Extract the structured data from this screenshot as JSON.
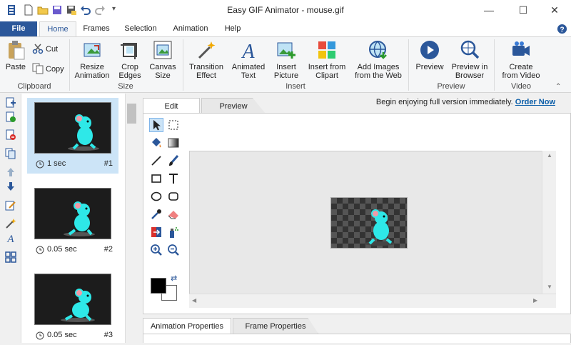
{
  "title": "Easy GIF Animator - mouse.gif",
  "window_controls": {
    "minimize": "—",
    "maximize": "☐",
    "close": "✕"
  },
  "ribbon_tabs": [
    "File",
    "Home",
    "Frames",
    "Selection",
    "Animation",
    "Help"
  ],
  "clipboard": {
    "paste": "Paste",
    "cut": "Cut",
    "copy": "Copy",
    "label": "Clipboard"
  },
  "size_group": {
    "resize": [
      "Resize",
      "Animation"
    ],
    "crop": [
      "Crop",
      "Edges"
    ],
    "canvas": [
      "Canvas",
      "Size"
    ],
    "label": "Size"
  },
  "insert_group": {
    "transition": [
      "Transition",
      "Effect"
    ],
    "animated_text": [
      "Animated",
      "Text"
    ],
    "insert_picture": [
      "Insert",
      "Picture"
    ],
    "insert_clipart": [
      "Insert from",
      "Clipart"
    ],
    "add_images": [
      "Add Images",
      "from the Web"
    ],
    "label": "Insert"
  },
  "preview_group": {
    "preview": "Preview",
    "preview_browser": [
      "Preview in",
      "Browser"
    ],
    "label": "Preview"
  },
  "video_group": {
    "create": [
      "Create",
      "from Video"
    ],
    "label": "Video"
  },
  "frames": [
    {
      "duration": "1 sec",
      "number": "#1",
      "selected": true
    },
    {
      "duration": "0.05 sec",
      "number": "#2",
      "selected": false
    },
    {
      "duration": "0.05 sec",
      "number": "#3",
      "selected": false
    }
  ],
  "editor_tabs": {
    "edit": "Edit",
    "preview": "Preview"
  },
  "promo": {
    "text": "Begin enjoying full version immediately.",
    "link": "Order Now"
  },
  "property_tabs": {
    "animation": "Animation Properties",
    "frame": "Frame Properties"
  },
  "colors": {
    "accent": "#2b579a",
    "link": "#0b5ea8",
    "mouse": "#2ee8e8",
    "selection": "#cce4f7"
  }
}
